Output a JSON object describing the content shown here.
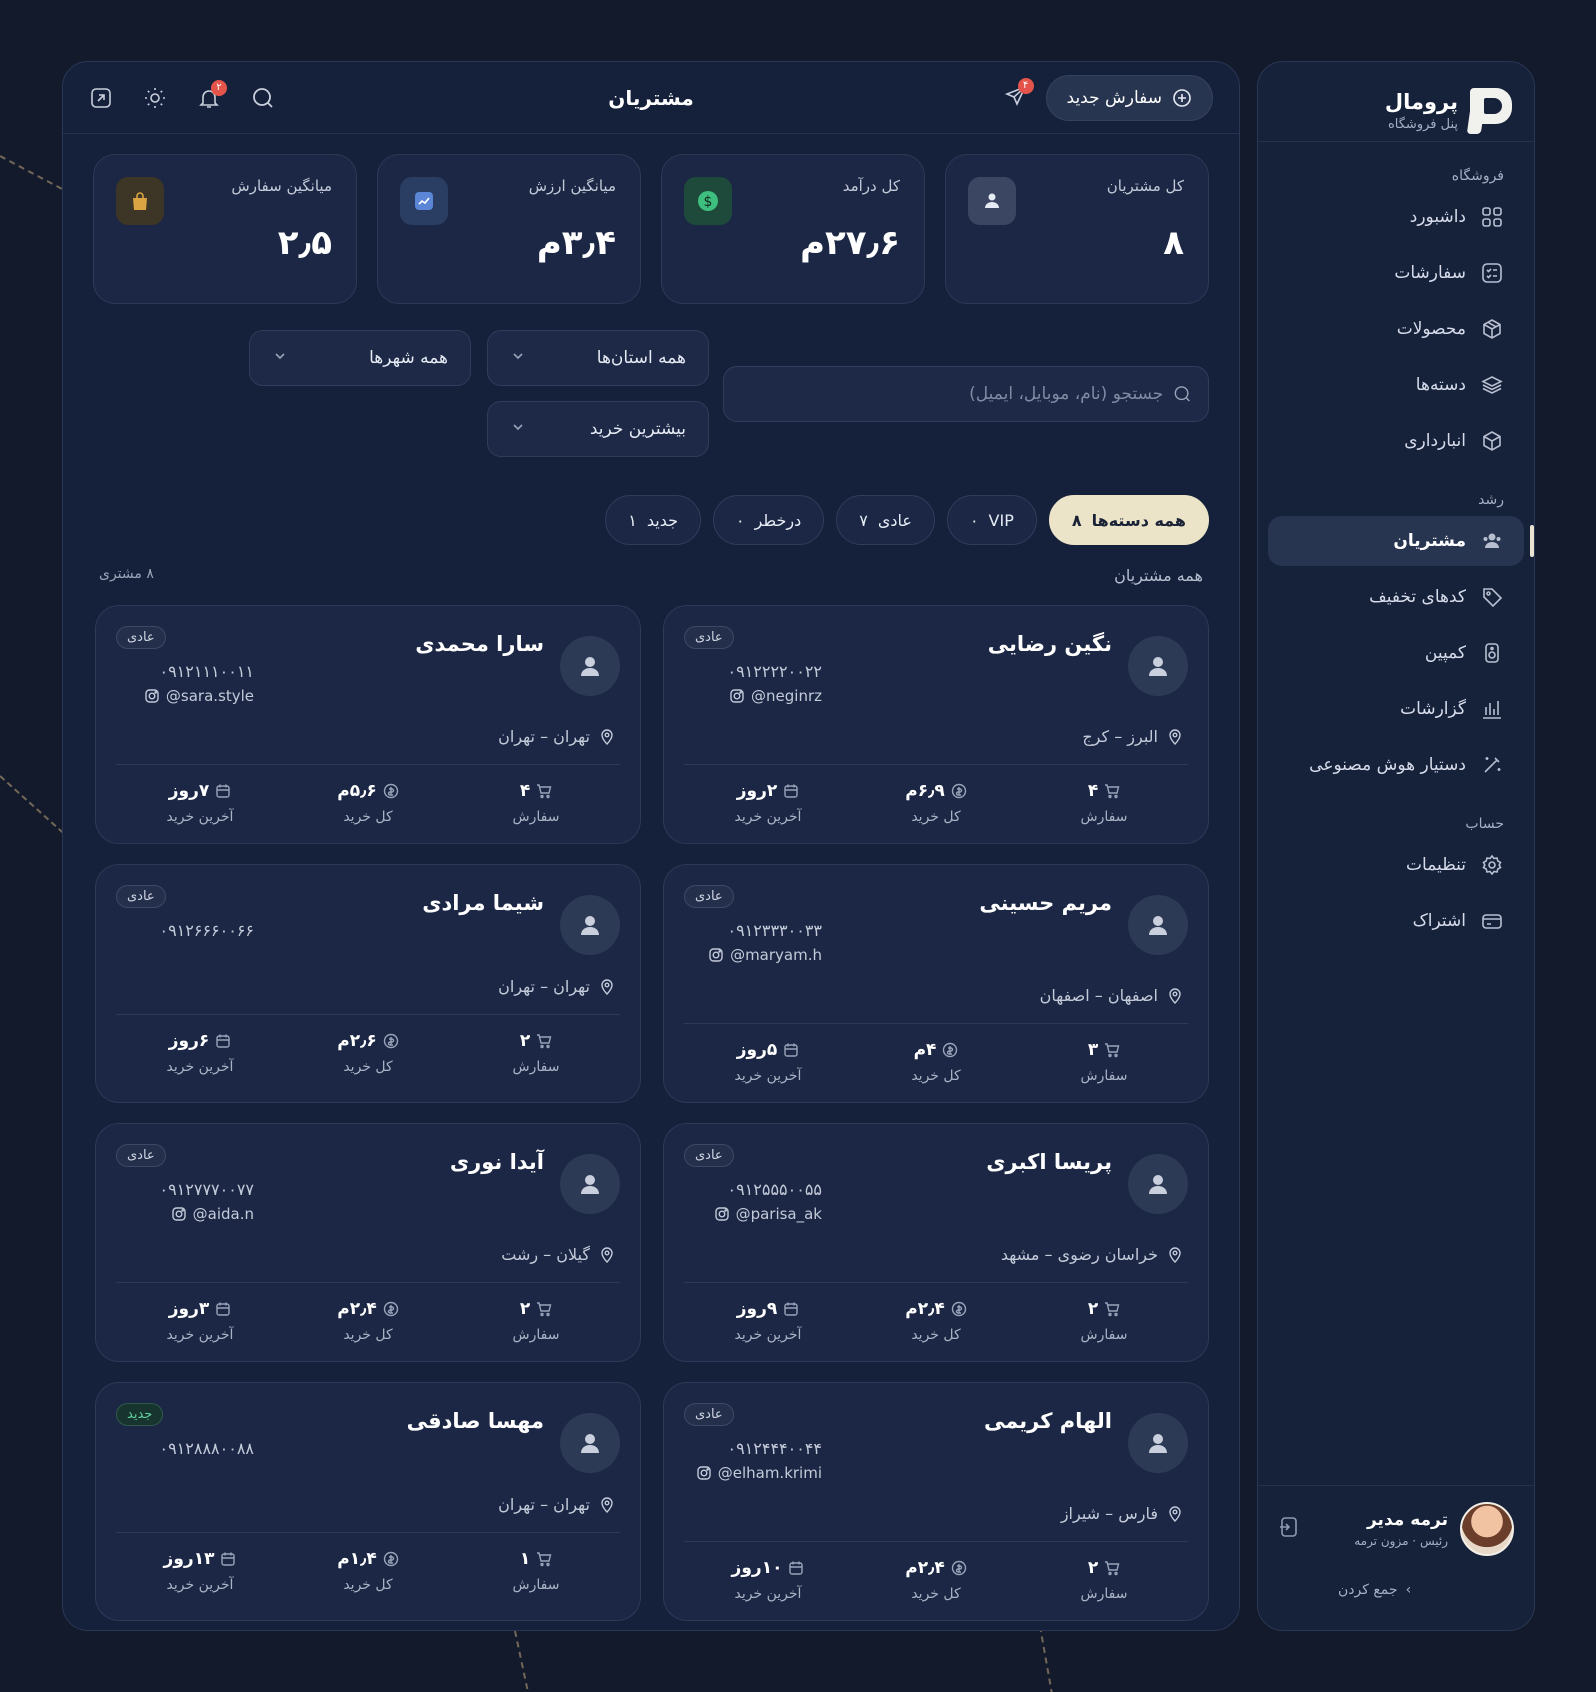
{
  "brand": {
    "title": "پرومال",
    "subtitle": "پنل فروشگاه"
  },
  "sidebar": {
    "sections": [
      {
        "label": "فروشگاه",
        "items": [
          {
            "label": "داشبورد",
            "icon": "grid-icon"
          },
          {
            "label": "سفارشات",
            "icon": "list-check-icon"
          },
          {
            "label": "محصولات",
            "icon": "box-icon"
          },
          {
            "label": "دسته‌ها",
            "icon": "layers-icon"
          },
          {
            "label": "انبارداری",
            "icon": "package-icon"
          }
        ]
      },
      {
        "label": "رشد",
        "items": [
          {
            "label": "مشتریان",
            "icon": "users-icon",
            "active": true
          },
          {
            "label": "کدهای تخفیف",
            "icon": "tag-icon"
          },
          {
            "label": "کمپین",
            "icon": "speaker-icon"
          },
          {
            "label": "گزارشات",
            "icon": "bar-chart-icon"
          },
          {
            "label": "دستیار هوش مصنوعی",
            "icon": "magic-wand-icon"
          }
        ]
      },
      {
        "label": "حساب",
        "items": [
          {
            "label": "تنظیمات",
            "icon": "gear-icon"
          },
          {
            "label": "اشتراک",
            "icon": "card-icon"
          }
        ]
      }
    ],
    "user": {
      "name": "ترمه مدیر",
      "role": "رئیس · مزون ترمه"
    },
    "collapse_label": "جمع کردن"
  },
  "topbar": {
    "title": "مشتریان",
    "new_order_label": "سفارش جدید",
    "send_badge": "۴",
    "notif_badge": "۲"
  },
  "stats": [
    {
      "label": "کل مشتریان",
      "value": "۸",
      "icon": "users-icon",
      "color": "#3a4662"
    },
    {
      "label": "کل درآمد",
      "value": "۲۷٫۶م",
      "icon": "dollar-icon",
      "color": "#1e4a3c"
    },
    {
      "label": "میانگین ارزش",
      "value": "۳٫۴م",
      "icon": "trend-icon",
      "color": "#2a3d63"
    },
    {
      "label": "میانگین سفارش",
      "value": "۲٫۵",
      "icon": "bag-icon",
      "color": "#3d3526"
    }
  ],
  "filters": {
    "search_placeholder": "جستجو (نام، موبایل، ایمیل)",
    "province": "همه استان‌ها",
    "city": "همه شهرها",
    "sort": "بیشترین خرید"
  },
  "chips": [
    {
      "label": "همه دسته‌ها",
      "count": "۸",
      "active": true
    },
    {
      "label": "VIP",
      "count": "۰"
    },
    {
      "label": "عادی",
      "count": "۷"
    },
    {
      "label": "درخطر",
      "count": "۰"
    },
    {
      "label": "جدید",
      "count": "۱"
    }
  ],
  "list": {
    "title": "همه مشتریان",
    "count": "۸ مشتری"
  },
  "labels": {
    "orders": "سفارش",
    "total": "کل خرید",
    "last": "آخرین خرید"
  },
  "customers": [
    {
      "name": "نگین رضایی",
      "phone": "۰۹۱۲۲۲۲۰۰۲۲",
      "insta": "@neginrz",
      "location": "البرز – کرج",
      "tag": "عادی",
      "orders": "۴",
      "total": "۶٫۹م",
      "last": "۲روز"
    },
    {
      "name": "سارا محمدی",
      "phone": "۰۹۱۲۱۱۱۰۰۱۱",
      "insta": "@sara.style",
      "location": "تهران – تهران",
      "tag": "عادی",
      "orders": "۴",
      "total": "۵٫۶م",
      "last": "۷روز"
    },
    {
      "name": "مریم حسینی",
      "phone": "۰۹۱۲۳۳۳۰۰۳۳",
      "insta": "@maryam.h",
      "location": "اصفهان – اصفهان",
      "tag": "عادی",
      "orders": "۳",
      "total": "۴م",
      "last": "۵روز"
    },
    {
      "name": "شیما مرادی",
      "phone": "۰۹۱۲۶۶۶۰۰۶۶",
      "insta": "",
      "location": "تهران – تهران",
      "tag": "عادی",
      "orders": "۲",
      "total": "۲٫۶م",
      "last": "۶روز"
    },
    {
      "name": "پریسا اکبری",
      "phone": "۰۹۱۲۵۵۵۰۰۵۵",
      "insta": "@parisa_ak",
      "location": "خراسان رضوی – مشهد",
      "tag": "عادی",
      "orders": "۲",
      "total": "۲٫۴م",
      "last": "۹روز"
    },
    {
      "name": "آیدا نوری",
      "phone": "۰۹۱۲۷۷۷۰۰۷۷",
      "insta": "@aida.n",
      "location": "گیلان – رشت",
      "tag": "عادی",
      "orders": "۲",
      "total": "۲٫۴م",
      "last": "۳روز"
    },
    {
      "name": "الهام کریمی",
      "phone": "۰۹۱۲۴۴۴۰۰۴۴",
      "insta": "@elham.krimi",
      "location": "فارس – شیراز",
      "tag": "عادی",
      "orders": "۲",
      "total": "۲٫۴م",
      "last": "۱۰روز"
    },
    {
      "name": "مهسا صادقی",
      "phone": "۰۹۱۲۸۸۸۰۰۸۸",
      "insta": "",
      "location": "تهران – تهران",
      "tag": "جدید",
      "orders": "۱",
      "total": "۱٫۴م",
      "last": "۱۳روز"
    }
  ]
}
